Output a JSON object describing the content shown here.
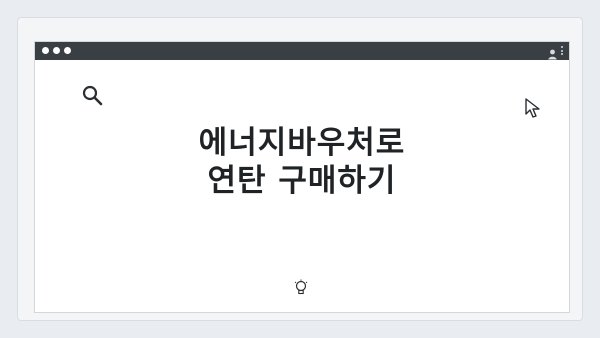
{
  "headline": {
    "line1": "에너지바우처로",
    "line2": "연탄 구매하기"
  },
  "icons": {
    "search": "search-icon",
    "cursor": "cursor-pointer-icon",
    "user": "user-icon",
    "menu": "kebab-menu-icon",
    "bulb": "lightbulb-icon"
  },
  "colors": {
    "titlebar": "#3a3f44",
    "background": "#e9edf1",
    "text": "#1f2326"
  }
}
